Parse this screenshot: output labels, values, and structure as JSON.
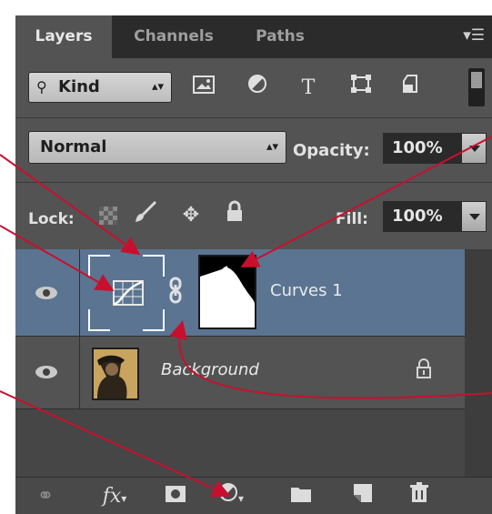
{
  "tabs": [
    {
      "label": "Layers",
      "active": true
    },
    {
      "label": "Channels",
      "active": false
    },
    {
      "label": "Paths",
      "active": false
    }
  ],
  "panel_menu_icon": "panel-menu-icon",
  "filter": {
    "kind_label": "Kind",
    "icons": [
      "pixel-layer-filter-icon",
      "adjustment-layer-filter-icon",
      "type-layer-filter-icon",
      "shape-layer-filter-icon",
      "smart-object-filter-icon"
    ]
  },
  "blend": {
    "mode": "Normal",
    "opacity_label": "Opacity:",
    "opacity_value": "100%"
  },
  "lock": {
    "label": "Lock:",
    "icons": [
      "lock-transparent-pixels-icon",
      "lock-image-pixels-icon",
      "lock-position-icon",
      "lock-all-icon"
    ],
    "fill_label": "Fill:",
    "fill_value": "100%"
  },
  "layers": [
    {
      "name": "Curves 1",
      "selected": true,
      "type": "adjustment"
    },
    {
      "name": "Background",
      "selected": false,
      "type": "image",
      "locked": true
    }
  ],
  "footer_icons": [
    "link-layers-icon",
    "fx-layer-style-icon",
    "add-mask-icon",
    "new-adjustment-layer-icon",
    "new-group-icon",
    "new-layer-icon",
    "delete-layer-icon"
  ],
  "colors": {
    "panel": "#535353",
    "selected_row": "#5a7491",
    "annotation_arrow": "#c8102e"
  }
}
